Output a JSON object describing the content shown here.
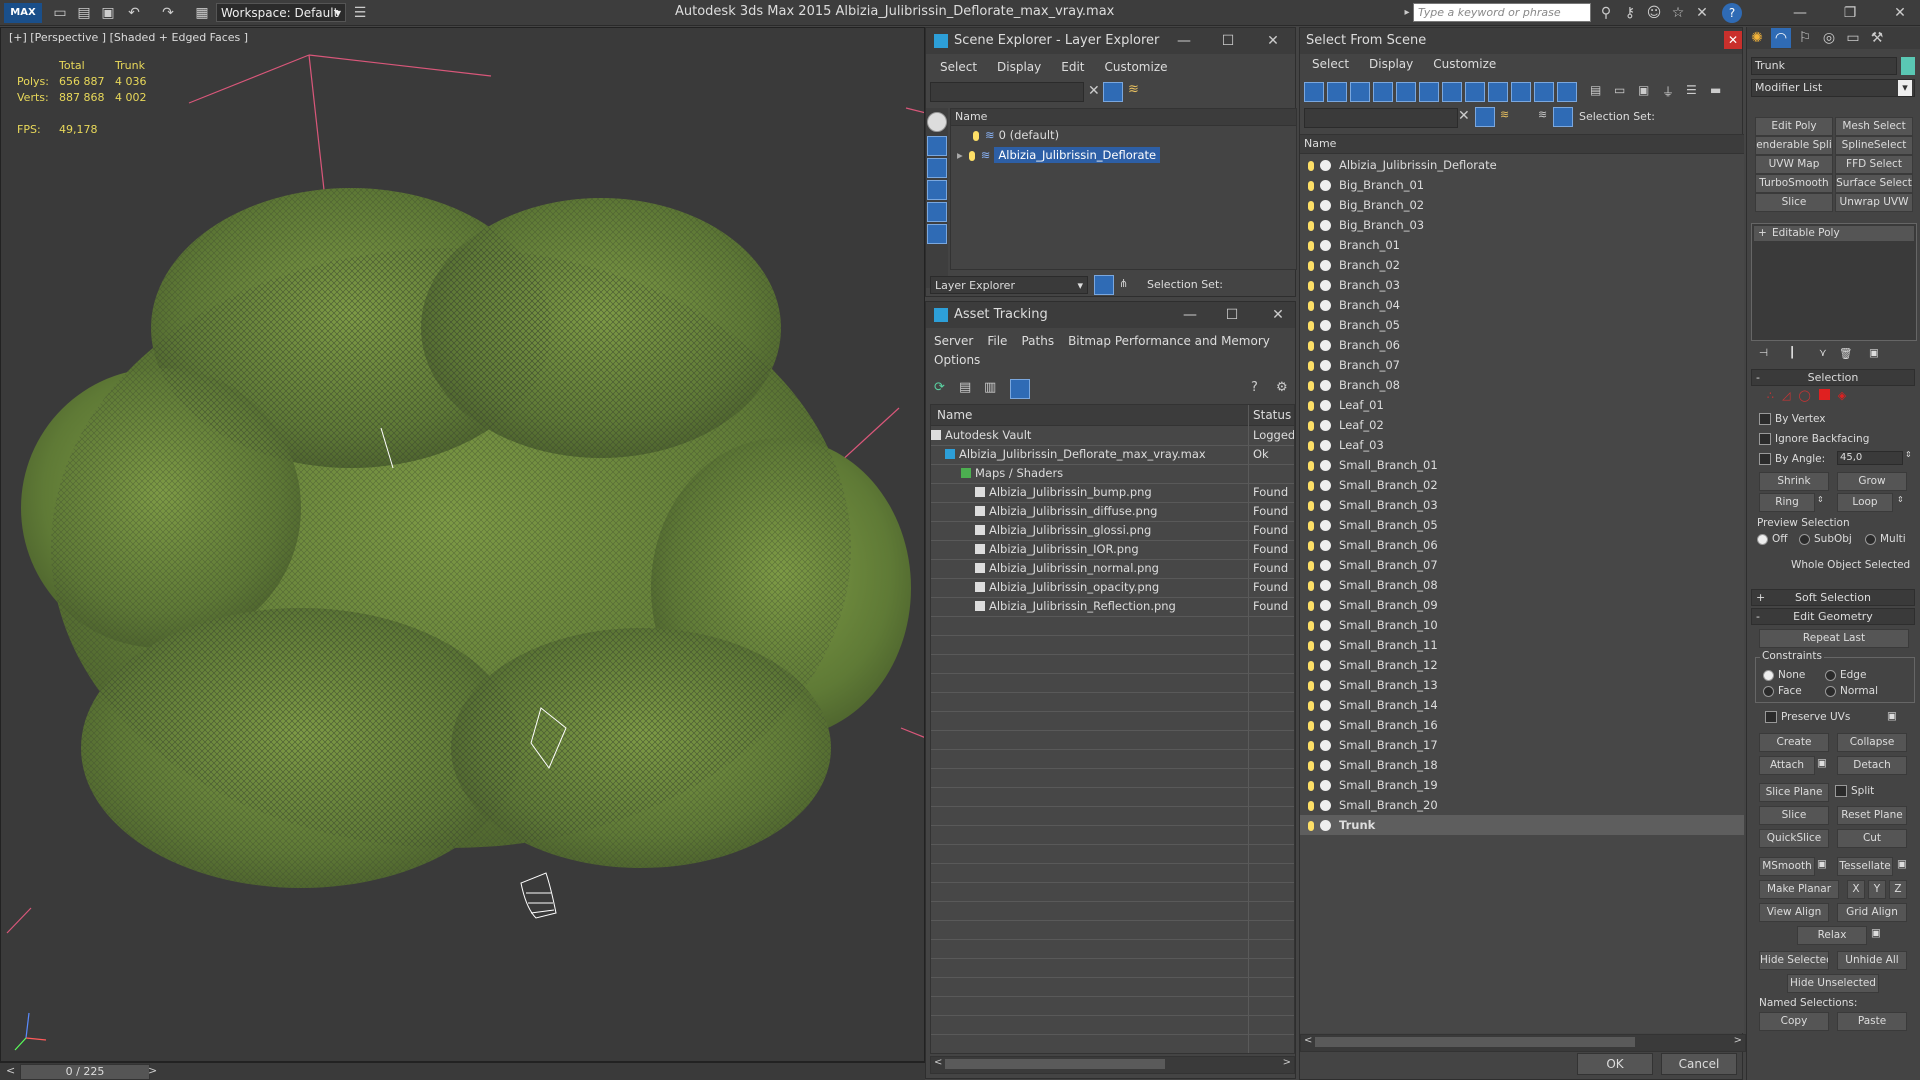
{
  "titlebar": {
    "workspace": "Workspace: Default",
    "app_title": "Autodesk 3ds Max  2015     Albizia_Julibrissin_Deflorate_max_vray.max",
    "search_placeholder": "Type a keyword or phrase"
  },
  "viewport": {
    "label": "[+] [Perspective ] [Shaded + Edged Faces ]",
    "stats": {
      "col_total": "Total",
      "col_trunk": "Trunk",
      "polys_label": "Polys:",
      "polys_total": "656 887",
      "polys_trunk": "4 036",
      "verts_label": "Verts:",
      "verts_total": "887 868",
      "verts_trunk": "4 002",
      "fps_label": "FPS:",
      "fps_value": "49,178"
    },
    "timeline": "0 / 225"
  },
  "scene_explorer": {
    "title": "Scene Explorer - Layer Explorer",
    "menu": [
      "Select",
      "Display",
      "Edit",
      "Customize"
    ],
    "col_name": "Name",
    "rows": [
      "0 (default)",
      "Albizia_Julibrissin_Deflorate"
    ],
    "footer_dropdown": "Layer Explorer",
    "footer_selection_set": "Selection Set:"
  },
  "asset_tracking": {
    "title": "Asset Tracking",
    "menu": [
      "Server",
      "File",
      "Paths",
      "Bitmap Performance and Memory"
    ],
    "menu2": "Options",
    "col_name": "Name",
    "col_status": "Status",
    "rows": [
      {
        "name": "Autodesk Vault",
        "status": "Logged"
      },
      {
        "name": "Albizia_Julibrissin_Deflorate_max_vray.max",
        "status": "Ok"
      },
      {
        "name": "Maps / Shaders",
        "status": ""
      },
      {
        "name": "Albizia_Julibrissin_bump.png",
        "status": "Found"
      },
      {
        "name": "Albizia_Julibrissin_diffuse.png",
        "status": "Found"
      },
      {
        "name": "Albizia_Julibrissin_glossi.png",
        "status": "Found"
      },
      {
        "name": "Albizia_Julibrissin_IOR.png",
        "status": "Found"
      },
      {
        "name": "Albizia_Julibrissin_normal.png",
        "status": "Found"
      },
      {
        "name": "Albizia_Julibrissin_opacity.png",
        "status": "Found"
      },
      {
        "name": "Albizia_Julibrissin_Reflection.png",
        "status": "Found"
      }
    ]
  },
  "select_from_scene": {
    "title": "Select From Scene",
    "menu": [
      "Select",
      "Display",
      "Customize"
    ],
    "selection_set": "Selection Set:",
    "col_name": "Name",
    "items": [
      "Albizia_Julibrissin_Deflorate",
      "Big_Branch_01",
      "Big_Branch_02",
      "Big_Branch_03",
      "Branch_01",
      "Branch_02",
      "Branch_03",
      "Branch_04",
      "Branch_05",
      "Branch_06",
      "Branch_07",
      "Branch_08",
      "Leaf_01",
      "Leaf_02",
      "Leaf_03",
      "Small_Branch_01",
      "Small_Branch_02",
      "Small_Branch_03",
      "Small_Branch_05",
      "Small_Branch_06",
      "Small_Branch_07",
      "Small_Branch_08",
      "Small_Branch_09",
      "Small_Branch_10",
      "Small_Branch_11",
      "Small_Branch_12",
      "Small_Branch_13",
      "Small_Branch_14",
      "Small_Branch_16",
      "Small_Branch_17",
      "Small_Branch_18",
      "Small_Branch_19",
      "Small_Branch_20",
      "Trunk"
    ],
    "ok": "OK",
    "cancel": "Cancel"
  },
  "command_panel": {
    "object_name": "Trunk",
    "modifier_list": "Modifier List",
    "buttons": [
      "Edit Poly",
      "Mesh Select",
      "enderable Spli",
      "SplineSelect",
      "UVW Map",
      "FFD Select",
      "TurboSmooth",
      "Surface Select",
      "Slice",
      "Unwrap UVW"
    ],
    "stack_item": "Editable Poly",
    "selection_header": "Selection",
    "by_vertex": "By Vertex",
    "ignore_backfacing": "Ignore Backfacing",
    "by_angle": "By Angle:",
    "angle_value": "45,0",
    "shrink": "Shrink",
    "grow": "Grow",
    "ring": "Ring",
    "loop": "Loop",
    "preview_selection": "Preview Selection",
    "preview_off": "Off",
    "preview_subobj": "SubObj",
    "preview_multi": "Multi",
    "whole_object": "Whole Object Selected",
    "soft_selection": "Soft Selection",
    "edit_geometry": "Edit Geometry",
    "repeat_last": "Repeat Last",
    "constraints": "Constraints",
    "c_none": "None",
    "c_edge": "Edge",
    "c_face": "Face",
    "c_normal": "Normal",
    "preserve_uvs": "Preserve UVs",
    "create": "Create",
    "collapse": "Collapse",
    "attach": "Attach",
    "detach": "Detach",
    "slice_plane": "Slice Plane",
    "split": "Split",
    "slice": "Slice",
    "reset_plane": "Reset Plane",
    "quickslice": "QuickSlice",
    "cut": "Cut",
    "msmooth": "MSmooth",
    "tessellate": "Tessellate",
    "make_planar": "Make Planar",
    "x": "X",
    "y": "Y",
    "z": "Z",
    "view_align": "View Align",
    "grid_align": "Grid Align",
    "relax": "Relax",
    "hide_selected": "Hide Selected",
    "unhide_all": "Unhide All",
    "hide_unselected": "Hide Unselected",
    "named_selections": "Named Selections:",
    "copy": "Copy",
    "paste": "Paste"
  }
}
